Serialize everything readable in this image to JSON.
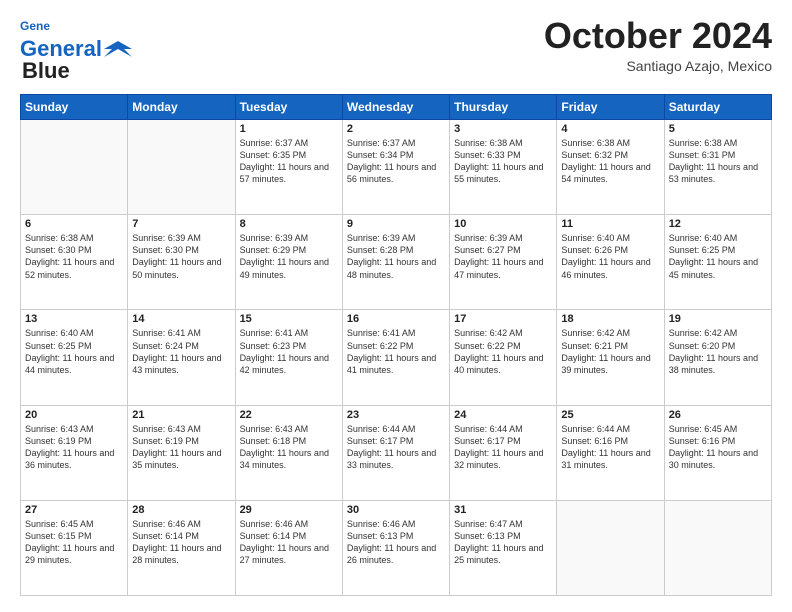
{
  "header": {
    "logo_line1": "General",
    "logo_line2": "Blue",
    "month": "October 2024",
    "location": "Santiago Azajo, Mexico"
  },
  "weekdays": [
    "Sunday",
    "Monday",
    "Tuesday",
    "Wednesday",
    "Thursday",
    "Friday",
    "Saturday"
  ],
  "weeks": [
    [
      {
        "day": "",
        "info": ""
      },
      {
        "day": "",
        "info": ""
      },
      {
        "day": "1",
        "info": "Sunrise: 6:37 AM\nSunset: 6:35 PM\nDaylight: 11 hours and 57 minutes."
      },
      {
        "day": "2",
        "info": "Sunrise: 6:37 AM\nSunset: 6:34 PM\nDaylight: 11 hours and 56 minutes."
      },
      {
        "day": "3",
        "info": "Sunrise: 6:38 AM\nSunset: 6:33 PM\nDaylight: 11 hours and 55 minutes."
      },
      {
        "day": "4",
        "info": "Sunrise: 6:38 AM\nSunset: 6:32 PM\nDaylight: 11 hours and 54 minutes."
      },
      {
        "day": "5",
        "info": "Sunrise: 6:38 AM\nSunset: 6:31 PM\nDaylight: 11 hours and 53 minutes."
      }
    ],
    [
      {
        "day": "6",
        "info": "Sunrise: 6:38 AM\nSunset: 6:30 PM\nDaylight: 11 hours and 52 minutes."
      },
      {
        "day": "7",
        "info": "Sunrise: 6:39 AM\nSunset: 6:30 PM\nDaylight: 11 hours and 50 minutes."
      },
      {
        "day": "8",
        "info": "Sunrise: 6:39 AM\nSunset: 6:29 PM\nDaylight: 11 hours and 49 minutes."
      },
      {
        "day": "9",
        "info": "Sunrise: 6:39 AM\nSunset: 6:28 PM\nDaylight: 11 hours and 48 minutes."
      },
      {
        "day": "10",
        "info": "Sunrise: 6:39 AM\nSunset: 6:27 PM\nDaylight: 11 hours and 47 minutes."
      },
      {
        "day": "11",
        "info": "Sunrise: 6:40 AM\nSunset: 6:26 PM\nDaylight: 11 hours and 46 minutes."
      },
      {
        "day": "12",
        "info": "Sunrise: 6:40 AM\nSunset: 6:25 PM\nDaylight: 11 hours and 45 minutes."
      }
    ],
    [
      {
        "day": "13",
        "info": "Sunrise: 6:40 AM\nSunset: 6:25 PM\nDaylight: 11 hours and 44 minutes."
      },
      {
        "day": "14",
        "info": "Sunrise: 6:41 AM\nSunset: 6:24 PM\nDaylight: 11 hours and 43 minutes."
      },
      {
        "day": "15",
        "info": "Sunrise: 6:41 AM\nSunset: 6:23 PM\nDaylight: 11 hours and 42 minutes."
      },
      {
        "day": "16",
        "info": "Sunrise: 6:41 AM\nSunset: 6:22 PM\nDaylight: 11 hours and 41 minutes."
      },
      {
        "day": "17",
        "info": "Sunrise: 6:42 AM\nSunset: 6:22 PM\nDaylight: 11 hours and 40 minutes."
      },
      {
        "day": "18",
        "info": "Sunrise: 6:42 AM\nSunset: 6:21 PM\nDaylight: 11 hours and 39 minutes."
      },
      {
        "day": "19",
        "info": "Sunrise: 6:42 AM\nSunset: 6:20 PM\nDaylight: 11 hours and 38 minutes."
      }
    ],
    [
      {
        "day": "20",
        "info": "Sunrise: 6:43 AM\nSunset: 6:19 PM\nDaylight: 11 hours and 36 minutes."
      },
      {
        "day": "21",
        "info": "Sunrise: 6:43 AM\nSunset: 6:19 PM\nDaylight: 11 hours and 35 minutes."
      },
      {
        "day": "22",
        "info": "Sunrise: 6:43 AM\nSunset: 6:18 PM\nDaylight: 11 hours and 34 minutes."
      },
      {
        "day": "23",
        "info": "Sunrise: 6:44 AM\nSunset: 6:17 PM\nDaylight: 11 hours and 33 minutes."
      },
      {
        "day": "24",
        "info": "Sunrise: 6:44 AM\nSunset: 6:17 PM\nDaylight: 11 hours and 32 minutes."
      },
      {
        "day": "25",
        "info": "Sunrise: 6:44 AM\nSunset: 6:16 PM\nDaylight: 11 hours and 31 minutes."
      },
      {
        "day": "26",
        "info": "Sunrise: 6:45 AM\nSunset: 6:16 PM\nDaylight: 11 hours and 30 minutes."
      }
    ],
    [
      {
        "day": "27",
        "info": "Sunrise: 6:45 AM\nSunset: 6:15 PM\nDaylight: 11 hours and 29 minutes."
      },
      {
        "day": "28",
        "info": "Sunrise: 6:46 AM\nSunset: 6:14 PM\nDaylight: 11 hours and 28 minutes."
      },
      {
        "day": "29",
        "info": "Sunrise: 6:46 AM\nSunset: 6:14 PM\nDaylight: 11 hours and 27 minutes."
      },
      {
        "day": "30",
        "info": "Sunrise: 6:46 AM\nSunset: 6:13 PM\nDaylight: 11 hours and 26 minutes."
      },
      {
        "day": "31",
        "info": "Sunrise: 6:47 AM\nSunset: 6:13 PM\nDaylight: 11 hours and 25 minutes."
      },
      {
        "day": "",
        "info": ""
      },
      {
        "day": "",
        "info": ""
      }
    ]
  ]
}
